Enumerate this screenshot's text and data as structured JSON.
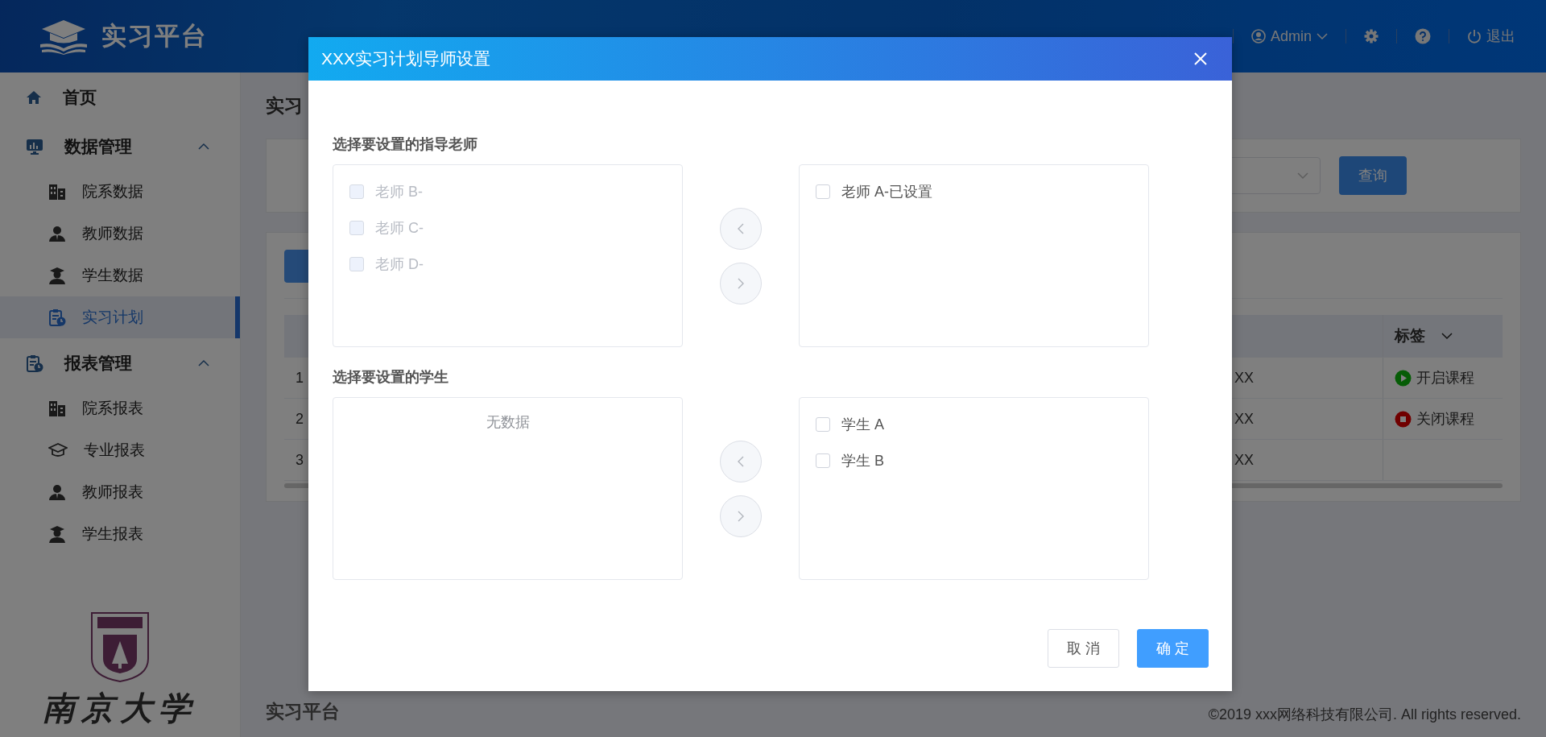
{
  "header": {
    "logo_text": "实习平台",
    "user": "Admin",
    "logout": "退出"
  },
  "sidebar": {
    "items": [
      {
        "label": "首页",
        "selected": false
      },
      {
        "label": "数据管理",
        "selected": false,
        "expanded": true,
        "children": [
          {
            "label": "院系数据",
            "selected": false
          },
          {
            "label": "教师数据",
            "selected": false
          },
          {
            "label": "学生数据",
            "selected": false
          },
          {
            "label": "实习计划",
            "selected": true
          }
        ]
      },
      {
        "label": "报表管理",
        "selected": false,
        "expanded": true,
        "children": [
          {
            "label": "院系报表",
            "selected": false
          },
          {
            "label": "专业报表",
            "selected": false
          },
          {
            "label": "教师报表",
            "selected": false
          },
          {
            "label": "学生报表",
            "selected": false
          }
        ]
      }
    ],
    "logo_text": "南京大学"
  },
  "page": {
    "title": "实习",
    "query_button": "查询",
    "table": {
      "tag_column": "标签",
      "rows": [
        {
          "index": "1",
          "column_3": "XX",
          "tag": {
            "kind": "open",
            "label": "开启课程"
          }
        },
        {
          "index": "2",
          "column_3": "XX",
          "tag": {
            "kind": "closed",
            "label": "关闭课程"
          }
        },
        {
          "index": "3",
          "column_3": "XX"
        }
      ]
    },
    "footer": {
      "brand": "实习平台",
      "copyright": "©2019 xxx网络科技有限公司. All rights reserved."
    }
  },
  "dialog": {
    "title": "XXX实习计划导师设置",
    "sections": [
      {
        "label": "选择要设置的指导老师",
        "source": [
          {
            "label": "老师 B-",
            "checked": false,
            "disabled": true
          },
          {
            "label": "老师 C-",
            "checked": false,
            "disabled": true
          },
          {
            "label": "老师 D-",
            "checked": false,
            "disabled": true
          }
        ],
        "target": [
          {
            "label": "老师 A-已设置",
            "checked": false,
            "disabled": false
          }
        ]
      },
      {
        "label": "选择要设置的学生",
        "source_empty": "无数据",
        "target": [
          {
            "label": "学生 A",
            "checked": false,
            "disabled": false
          },
          {
            "label": "学生 B",
            "checked": false,
            "disabled": false
          }
        ]
      }
    ],
    "buttons": [
      {
        "label": "取 消",
        "kind": "default"
      },
      {
        "label": "确 定",
        "kind": "primary"
      }
    ]
  }
}
